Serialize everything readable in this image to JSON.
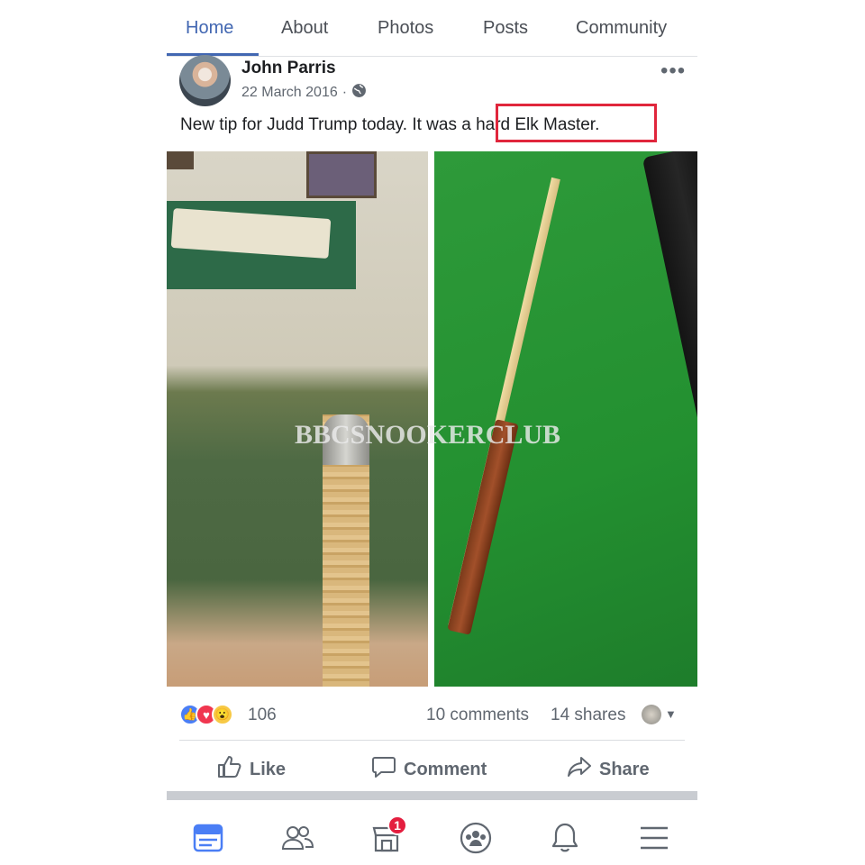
{
  "tabs": [
    {
      "label": "Home",
      "active": true
    },
    {
      "label": "About"
    },
    {
      "label": "Photos"
    },
    {
      "label": "Posts"
    },
    {
      "label": "Community"
    }
  ],
  "post": {
    "author": "John Parris",
    "date": "22 March 2016",
    "date_separator": "·",
    "audience_icon": "globe-icon",
    "text": "New tip for Judd Trump today. It was a hard Elk Master.",
    "more_icon": "more-icon",
    "watermark": "BBCSNOOKERCLUB"
  },
  "stats": {
    "reactions": [
      "like",
      "love",
      "wow"
    ],
    "reaction_count": "106",
    "comments": "10 comments",
    "shares": "14 shares"
  },
  "actions": {
    "like": "Like",
    "comment": "Comment",
    "share": "Share"
  },
  "bottom_nav": {
    "items": [
      "news-feed-icon",
      "friends-icon",
      "marketplace-icon",
      "groups-icon",
      "notifications-icon",
      "menu-icon"
    ],
    "marketplace_badge": "1"
  },
  "colors": {
    "accent": "#4267b2",
    "highlight_box": "#e0263c",
    "badge": "#e41e3f"
  }
}
